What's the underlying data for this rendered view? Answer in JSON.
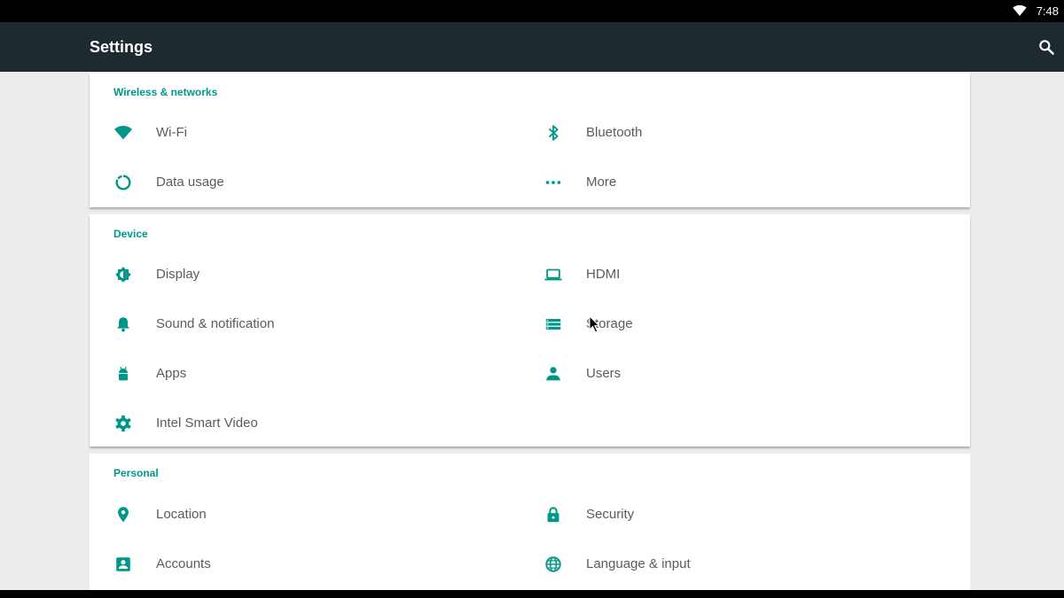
{
  "status_bar": {
    "time": "7:48",
    "wifi_icon": "wifi-icon"
  },
  "app_bar": {
    "title": "Settings",
    "search_icon": "search-icon"
  },
  "sections": [
    {
      "header": "Wireless & networks",
      "items": [
        {
          "label": "Wi-Fi",
          "icon": "wifi-icon"
        },
        {
          "label": "Bluetooth",
          "icon": "bluetooth-icon"
        },
        {
          "label": "Data usage",
          "icon": "data-usage-icon"
        },
        {
          "label": "More",
          "icon": "more-icon"
        }
      ]
    },
    {
      "header": "Device",
      "items": [
        {
          "label": "Display",
          "icon": "brightness-icon"
        },
        {
          "label": "HDMI",
          "icon": "laptop-icon"
        },
        {
          "label": "Sound & notification",
          "icon": "bell-icon"
        },
        {
          "label": "Storage",
          "icon": "storage-icon"
        },
        {
          "label": "Apps",
          "icon": "android-icon"
        },
        {
          "label": "Users",
          "icon": "person-icon"
        },
        {
          "label": "Intel Smart Video",
          "icon": "gear-icon"
        }
      ]
    },
    {
      "header": "Personal",
      "items": [
        {
          "label": "Location",
          "icon": "location-pin-icon"
        },
        {
          "label": "Security",
          "icon": "lock-icon"
        },
        {
          "label": "Accounts",
          "icon": "account-box-icon"
        },
        {
          "label": "Language & input",
          "icon": "globe-icon"
        }
      ]
    }
  ],
  "colors": {
    "accent": "#009688",
    "app_bar": "#1d2b31",
    "background": "#ececec",
    "label_text": "#5b5b5b"
  }
}
